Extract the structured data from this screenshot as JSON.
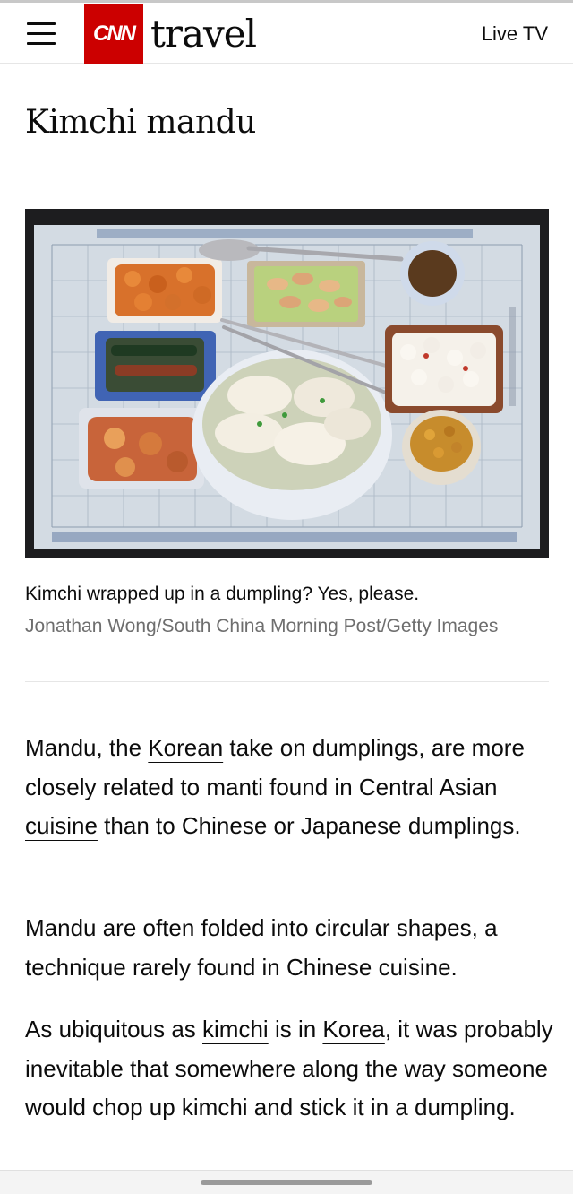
{
  "header": {
    "logo_brand": "CNN",
    "logo_section": "travel",
    "live_tv_label": "Live TV",
    "icons": {
      "menu": "hamburger-menu-icon"
    }
  },
  "article": {
    "title": "Kimchi mandu",
    "image": {
      "caption": "Kimchi wrapped up in a dumpling? Yes, please.",
      "credit": "Jonathan Wong/South China Morning Post/Getty Images"
    },
    "paragraphs": [
      {
        "t1": "Mandu, the",
        "l1": "Korean",
        "t2": "take on dumplings, are more closely related to manti found in Central Asian",
        "l2": "cuisine",
        "t3": "than to Chinese or Japanese dumplings."
      },
      {
        "t1": "Mandu are often folded into circular shapes, a technique rarely found in",
        "l1": "Chinese cuisine",
        "t2": "."
      },
      {
        "t1": "As ubiquitous as",
        "l1": "kimchi",
        "t2": "is in",
        "l2": "Korea",
        "t3": ", it was probably inevitable that somewhere along the way someone would chop up kimchi and stick it in a dumpling."
      }
    ]
  },
  "colors": {
    "brand_red": "#cc0000",
    "text": "#0c0c0c",
    "credit_gray": "#6e6e6e"
  }
}
